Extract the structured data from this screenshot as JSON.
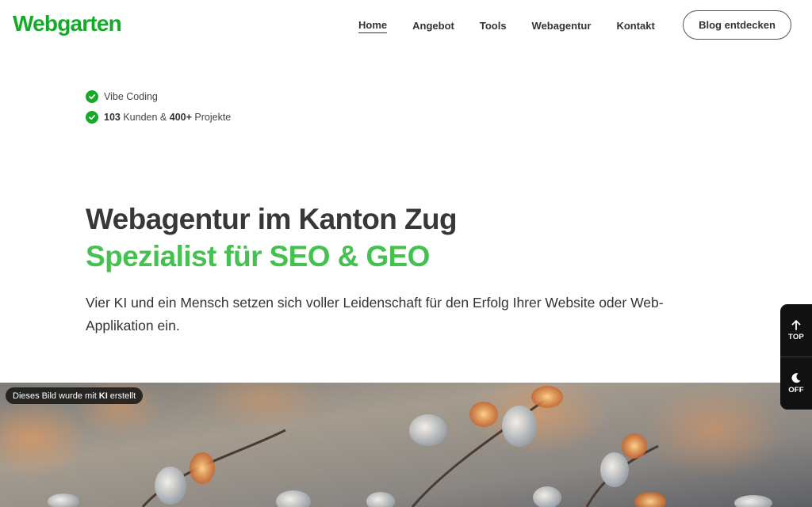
{
  "header": {
    "logo": "Webgarten",
    "nav": [
      {
        "label": "Home",
        "active": true
      },
      {
        "label": "Angebot",
        "active": false
      },
      {
        "label": "Tools",
        "active": false
      },
      {
        "label": "Webagentur",
        "active": false
      },
      {
        "label": "Kontakt",
        "active": false
      }
    ],
    "cta_label": "Blog entdecken"
  },
  "highlights": {
    "item1": "Vibe Coding",
    "item2": {
      "customers": "103",
      "customers_label": "Kunden &",
      "projects": "400+",
      "projects_label": "Projekte"
    }
  },
  "hero": {
    "title": "Webagentur im Kanton Zug",
    "subtitle": "Spezialist für SEO & GEO",
    "description": "Vier KI und ein Mensch setzen sich voller Leidenschaft für den Erfolg Ihrer Website oder Web-Applikation ein."
  },
  "image_badge": {
    "before": "Dieses Bild wurde mit",
    "strong": "KI",
    "after": "erstellt"
  },
  "side_widget": {
    "top_label": "TOP",
    "theme_label": "OFF"
  },
  "colors": {
    "brand": "#15a92a",
    "accent": "#44c14f",
    "text": "#333333",
    "widget": "#111111"
  }
}
